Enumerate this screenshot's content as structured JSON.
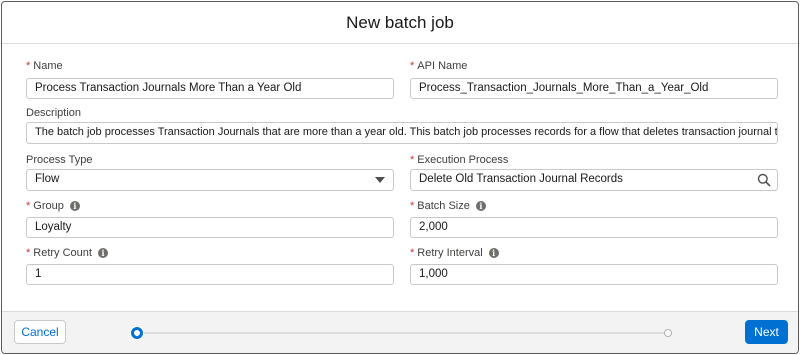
{
  "modal": {
    "title": "New batch job"
  },
  "fields": {
    "name": {
      "label": "Name",
      "value": "Process Transaction Journals More Than a Year Old"
    },
    "api_name": {
      "label": "API Name",
      "value": "Process_Transaction_Journals_More_Than_a_Year_Old"
    },
    "description": {
      "label": "Description",
      "value": "The batch job processes Transaction Journals that are more than a year old. This batch job processes records for a flow that deletes transaction journal that are more than a year old."
    },
    "process_type": {
      "label": "Process Type",
      "value": "Flow"
    },
    "execution_process": {
      "label": "Execution Process",
      "value": "Delete Old Transaction Journal Records"
    },
    "group": {
      "label": "Group",
      "value": "Loyalty"
    },
    "batch_size": {
      "label": "Batch Size",
      "value": "2,000"
    },
    "retry_count": {
      "label": "Retry Count",
      "value": "1"
    },
    "retry_interval": {
      "label": "Retry Interval",
      "value": "1,000"
    }
  },
  "footer": {
    "cancel_label": "Cancel",
    "next_label": "Next",
    "progress_current_step": 1,
    "progress_total_steps": 2
  },
  "colors": {
    "brand": "#0070d2",
    "required": "#c23934",
    "border": "#c9c9c9"
  },
  "icons": {
    "info": "info-icon",
    "search": "search-icon",
    "dropdown": "chevron-down-icon"
  }
}
